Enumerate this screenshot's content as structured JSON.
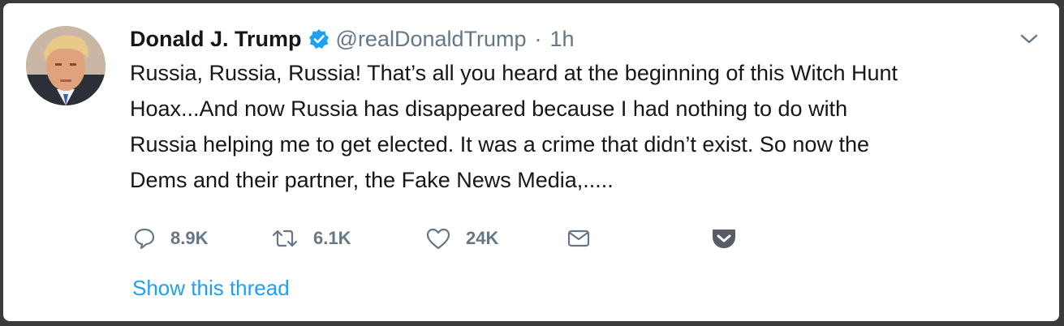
{
  "tweet": {
    "display_name": "Donald J. Trump",
    "handle": "@realDonaldTrump",
    "separator": "·",
    "time": "1h",
    "lines": [
      "Russia, Russia, Russia! That’s all you heard at the beginning of this Witch Hunt",
      "Hoax...And now Russia has disappeared because I had nothing to do with",
      "Russia helping me to get elected. It was a crime that didn’t exist. So now the",
      "Dems and their partner, the Fake News Media,....."
    ],
    "show_thread_label": "Show this thread"
  },
  "actions": {
    "reply_count": "8.9K",
    "retweet_count": "6.1K",
    "like_count": "24K"
  },
  "icons": {
    "reply": "reply-icon",
    "retweet": "retweet-icon",
    "like": "heart-icon",
    "dm": "envelope-icon",
    "pocket": "pocket-icon",
    "caret": "chevron-down-icon",
    "verified": "verified-badge-icon"
  },
  "colors": {
    "text": "#14171a",
    "secondary": "#657786",
    "link": "#1da1f2",
    "verified": "#1da1f2",
    "pocket": "#585c66"
  }
}
